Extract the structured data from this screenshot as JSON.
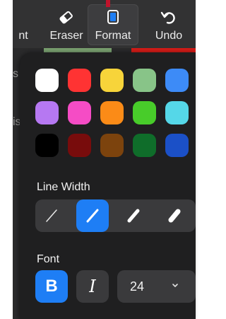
{
  "toolbar": {
    "partial_label": "nt",
    "eraser_label": "Eraser",
    "format_label": "Format",
    "undo_label": "Undo"
  },
  "background_fragments": [
    "s",
    "is"
  ],
  "colors": [
    {
      "name": "white",
      "hex": "#ffffff"
    },
    {
      "name": "red",
      "hex": "#ff3333"
    },
    {
      "name": "yellow",
      "hex": "#f7d43a"
    },
    {
      "name": "light-green",
      "hex": "#88c488"
    },
    {
      "name": "blue",
      "hex": "#3d8bf7"
    },
    {
      "name": "lavender",
      "hex": "#b678f2"
    },
    {
      "name": "pink",
      "hex": "#f54cc5"
    },
    {
      "name": "orange",
      "hex": "#fb8b17"
    },
    {
      "name": "green",
      "hex": "#48cc2a"
    },
    {
      "name": "cyan",
      "hex": "#55d7e8"
    },
    {
      "name": "black",
      "hex": "#000000"
    },
    {
      "name": "dark-red",
      "hex": "#780c0c"
    },
    {
      "name": "brown",
      "hex": "#7c430d"
    },
    {
      "name": "dark-green",
      "hex": "#0f6d2a"
    },
    {
      "name": "dark-blue",
      "hex": "#1b50c7"
    }
  ],
  "line_width": {
    "label": "Line Width",
    "options": [
      "thin",
      "medium",
      "thick",
      "extra-thick"
    ],
    "selected": "medium"
  },
  "font": {
    "label": "Font",
    "bold_label": "B",
    "italic_label": "I",
    "bold_active": true,
    "size": "24"
  },
  "accent_color": "#1e7ef5"
}
